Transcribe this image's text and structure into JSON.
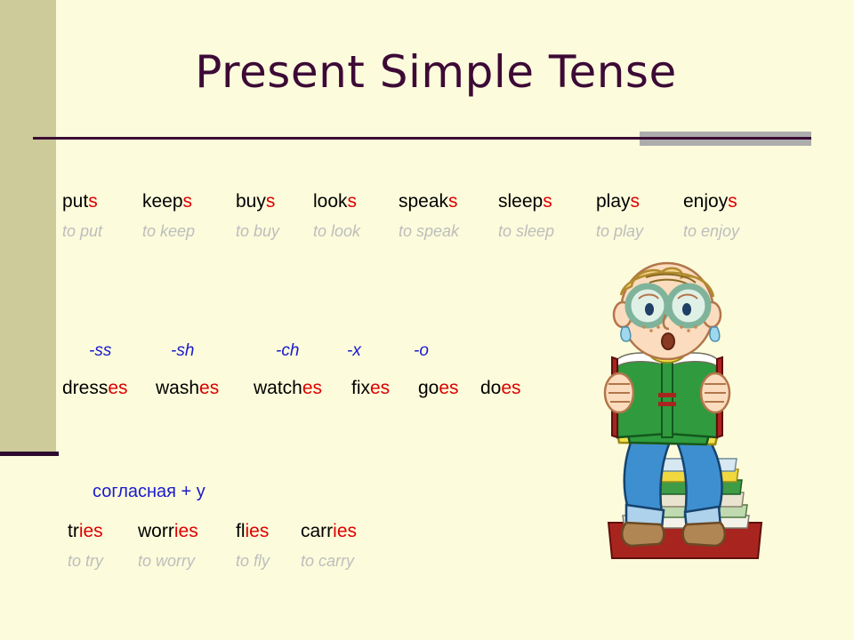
{
  "slide": {
    "title": "Present Simple Tense",
    "background_color": "#FCFCDC",
    "accent_color": "#CCCB99",
    "title_color": "#3D0A36",
    "rule_line_color": "#3A0C34",
    "rule_accent_color": "#ADADAD",
    "ending_color": "#DD0000",
    "label_color": "#1A1ACC",
    "infinitive_color": "#BDBDBD"
  },
  "sections": {
    "s_rule": {
      "verbs": [
        {
          "stem": "put",
          "ending": "s",
          "infinitive": "to put"
        },
        {
          "stem": "keep",
          "ending": "s",
          "infinitive": "to keep"
        },
        {
          "stem": "buy",
          "ending": "s",
          "infinitive": "to buy"
        },
        {
          "stem": "look",
          "ending": "s",
          "infinitive": "to look"
        },
        {
          "stem": "speak",
          "ending": "s",
          "infinitive": "to speak"
        },
        {
          "stem": "sleep",
          "ending": "s",
          "infinitive": "to sleep"
        },
        {
          "stem": "play",
          "ending": "s",
          "infinitive": "to play"
        },
        {
          "stem": "enjoy",
          "ending": "s",
          "infinitive": "to enjoy"
        }
      ]
    },
    "es_rule": {
      "labels": [
        "-ss",
        "-sh",
        "-ch",
        "-x",
        "-o"
      ],
      "verbs": [
        {
          "stem": "dress",
          "ending": "es",
          "infinitive": ""
        },
        {
          "stem": "wash",
          "ending": "es",
          "infinitive": ""
        },
        {
          "stem": "watch",
          "ending": "es",
          "infinitive": ""
        },
        {
          "stem": "fix",
          "ending": "es",
          "infinitive": ""
        },
        {
          "stem": "go",
          "ending": "es",
          "infinitive": ""
        },
        {
          "stem": "do",
          "ending": "es",
          "infinitive": ""
        }
      ]
    },
    "y_rule": {
      "note": "согласная + y",
      "verbs": [
        {
          "stem": "tr",
          "ending": "ies",
          "infinitive": "to try"
        },
        {
          "stem": "worr",
          "ending": "ies",
          "infinitive": "to worry"
        },
        {
          "stem": "fl",
          "ending": "ies",
          "infinitive": "to fly"
        },
        {
          "stem": "carr",
          "ending": "ies",
          "infinitive": "to carry"
        }
      ]
    }
  },
  "illustration": {
    "name": "boy-reading-book-on-stack-of-books",
    "hair_color": "#F2D48C",
    "glasses_color": "#7FB39B",
    "sweater_color": "#2F9B3E",
    "shirt_color": "#F5E04A",
    "jeans_color": "#3E8FD0",
    "shoes_color": "#B08654",
    "book_color": "#2F9B3E"
  }
}
